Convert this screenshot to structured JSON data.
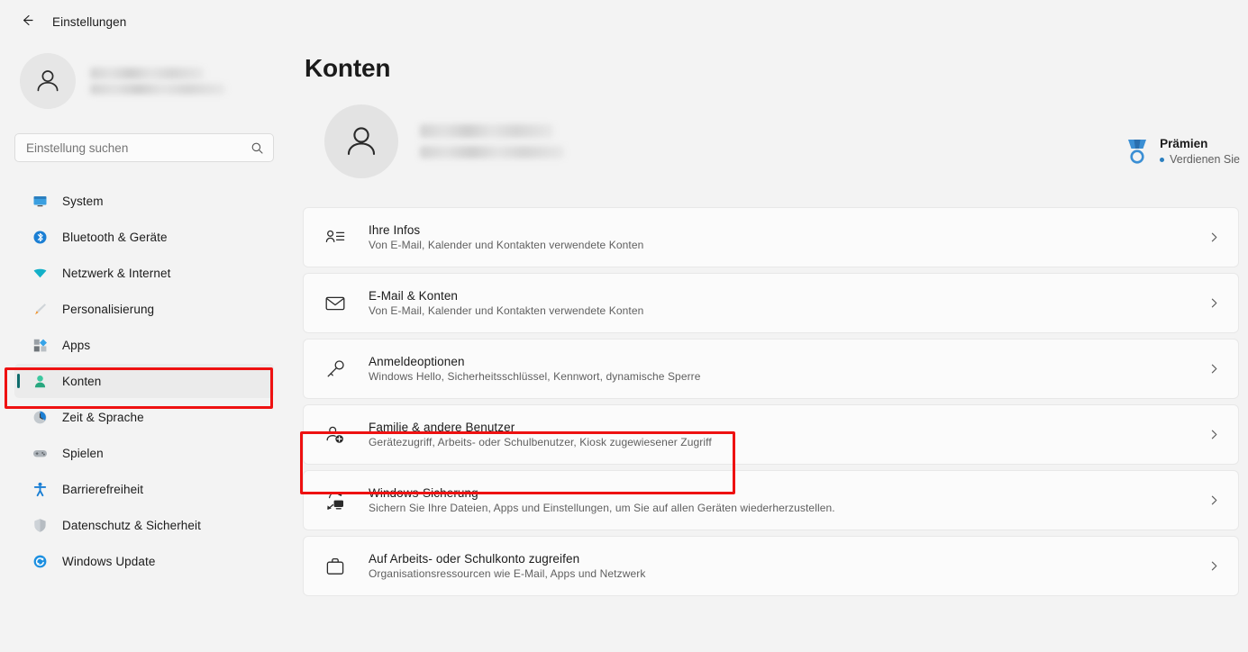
{
  "titlebar": {
    "back_icon": "back-arrow-icon",
    "title": "Einstellungen"
  },
  "sidebar": {
    "profile": {
      "avatar_icon": "person-avatar-icon",
      "name_redacted": "",
      "email_redacted": ""
    },
    "search": {
      "placeholder": "Einstellung suchen",
      "value": "",
      "icon": "search-icon"
    },
    "items": [
      {
        "label": "System",
        "icon": "monitor-icon",
        "active": false
      },
      {
        "label": "Bluetooth & Geräte",
        "icon": "bluetooth-icon",
        "active": false
      },
      {
        "label": "Netzwerk & Internet",
        "icon": "wifi-icon",
        "active": false
      },
      {
        "label": "Personalisierung",
        "icon": "paintbrush-icon",
        "active": false
      },
      {
        "label": "Apps",
        "icon": "apps-icon",
        "active": false
      },
      {
        "label": "Konten",
        "icon": "accounts-person-icon",
        "active": true
      },
      {
        "label": "Zeit & Sprache",
        "icon": "clock-icon",
        "active": false
      },
      {
        "label": "Spielen",
        "icon": "gamepad-icon",
        "active": false
      },
      {
        "label": "Barrierefreiheit",
        "icon": "accessibility-icon",
        "active": false
      },
      {
        "label": "Datenschutz & Sicherheit",
        "icon": "shield-icon",
        "active": false
      },
      {
        "label": "Windows Update",
        "icon": "update-refresh-icon",
        "active": false
      }
    ]
  },
  "main": {
    "page_title": "Konten",
    "account_header": {
      "avatar_icon": "person-avatar-icon",
      "name_redacted": "",
      "account_redacted": ""
    },
    "rewards": {
      "icon": "medal-icon",
      "title": "Prämien",
      "subtitle": "Verdienen Sie",
      "bullet_color": "#2b7fbf"
    },
    "settings_rows": [
      {
        "icon": "your-info-icon",
        "title": "Ihre Infos",
        "subtitle": "Von E-Mail, Kalender und Kontakten verwendete Konten",
        "chevron": "chevron-right-icon",
        "highlighted": false
      },
      {
        "icon": "envelope-icon",
        "title": "E-Mail & Konten",
        "subtitle": "Von E-Mail, Kalender und Kontakten verwendete Konten",
        "chevron": "chevron-right-icon",
        "highlighted": false
      },
      {
        "icon": "key-icon",
        "title": "Anmeldeoptionen",
        "subtitle": "Windows Hello, Sicherheitsschlüssel, Kennwort, dynamische Sperre",
        "chevron": "chevron-right-icon",
        "highlighted": false
      },
      {
        "icon": "person-add-icon",
        "title": "Familie & andere Benutzer",
        "subtitle": "Gerätezugriff, Arbeits- oder Schulbenutzer, Kiosk zugewiesener Zugriff",
        "chevron": "chevron-right-icon",
        "highlighted": true
      },
      {
        "icon": "backup-sync-icon",
        "title": "Windows-Sicherung",
        "subtitle": "Sichern Sie Ihre Dateien, Apps und Einstellungen, um Sie auf allen Geräten wiederherzustellen.",
        "chevron": "chevron-right-icon",
        "highlighted": false
      },
      {
        "icon": "briefcase-icon",
        "title": "Auf Arbeits- oder Schulkonto zugreifen",
        "subtitle": "Organisationsressourcen wie E-Mail, Apps und Netzwerk",
        "chevron": "chevron-right-icon",
        "highlighted": false
      }
    ]
  },
  "annotations": {
    "highlight_color": "#ee1111",
    "boxes": [
      {
        "name": "konten-sidebar-highlight"
      },
      {
        "name": "familie-row-highlight"
      }
    ]
  },
  "colors": {
    "page_bg": "#f3f3f3",
    "card_bg": "#fbfbfb",
    "accent_teal": "#0f6c6c",
    "text_primary": "#1b1b1b",
    "text_secondary": "#5f5f5f"
  }
}
